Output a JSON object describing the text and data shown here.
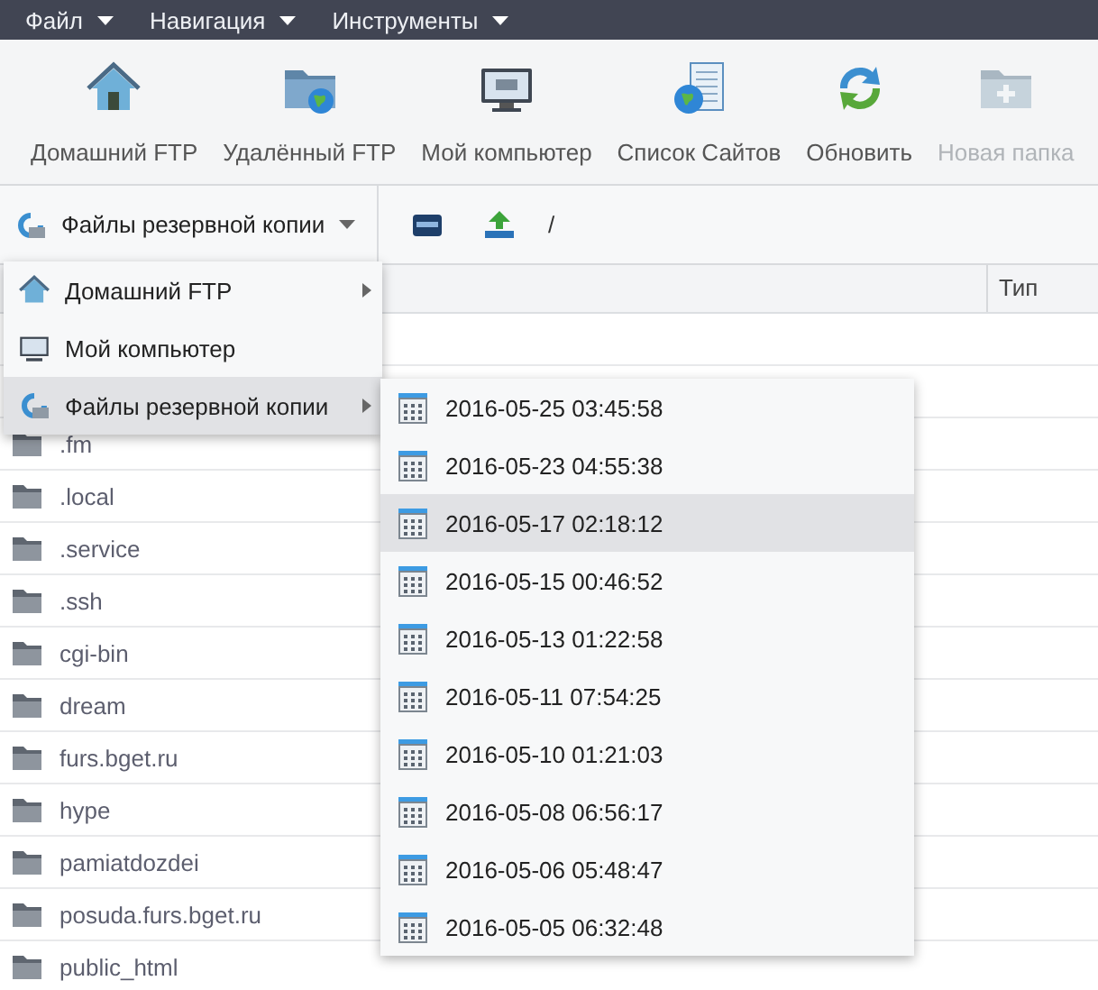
{
  "menubar": [
    {
      "label": "Файл"
    },
    {
      "label": "Навигация"
    },
    {
      "label": "Инструменты"
    }
  ],
  "toolbar": [
    {
      "label": "Домашний FTP",
      "kind": "home",
      "disabled": false
    },
    {
      "label": "Удалённый FTP",
      "kind": "remote",
      "disabled": false
    },
    {
      "label": "Мой компьютер",
      "kind": "computer",
      "disabled": false
    },
    {
      "label": "Список Сайтов",
      "kind": "sites",
      "disabled": false
    },
    {
      "label": "Обновить",
      "kind": "refresh",
      "disabled": false
    },
    {
      "label": "Новая папка",
      "kind": "new-folder",
      "disabled": true
    }
  ],
  "location": {
    "source": "Файлы резервной копии",
    "path": "/"
  },
  "table": {
    "type_header": "Тип",
    "rows": [
      {
        "name": ".fm"
      },
      {
        "name": ".local"
      },
      {
        "name": ".service"
      },
      {
        "name": ".ssh"
      },
      {
        "name": "cgi-bin"
      },
      {
        "name": "dream"
      },
      {
        "name": "furs.bget.ru"
      },
      {
        "name": "hype"
      },
      {
        "name": "pamiatdozdei"
      },
      {
        "name": "posuda.furs.bget.ru"
      },
      {
        "name": "public_html"
      }
    ]
  },
  "source_menu": [
    {
      "label": "Домашний FTP",
      "kind": "home",
      "submenu": true,
      "selected": false
    },
    {
      "label": "Мой компьютер",
      "kind": "computer",
      "submenu": false,
      "selected": false
    },
    {
      "label": "Файлы резервной копии",
      "kind": "backup",
      "submenu": true,
      "selected": true
    }
  ],
  "backup_menu": [
    {
      "label": "2016-05-25 03:45:58",
      "selected": false
    },
    {
      "label": "2016-05-23 04:55:38",
      "selected": false
    },
    {
      "label": "2016-05-17 02:18:12",
      "selected": true
    },
    {
      "label": "2016-05-15 00:46:52",
      "selected": false
    },
    {
      "label": "2016-05-13 01:22:58",
      "selected": false
    },
    {
      "label": "2016-05-11 07:54:25",
      "selected": false
    },
    {
      "label": "2016-05-10 01:21:03",
      "selected": false
    },
    {
      "label": "2016-05-08 06:56:17",
      "selected": false
    },
    {
      "label": "2016-05-06 05:48:47",
      "selected": false
    },
    {
      "label": "2016-05-05 06:32:48",
      "selected": false
    }
  ]
}
